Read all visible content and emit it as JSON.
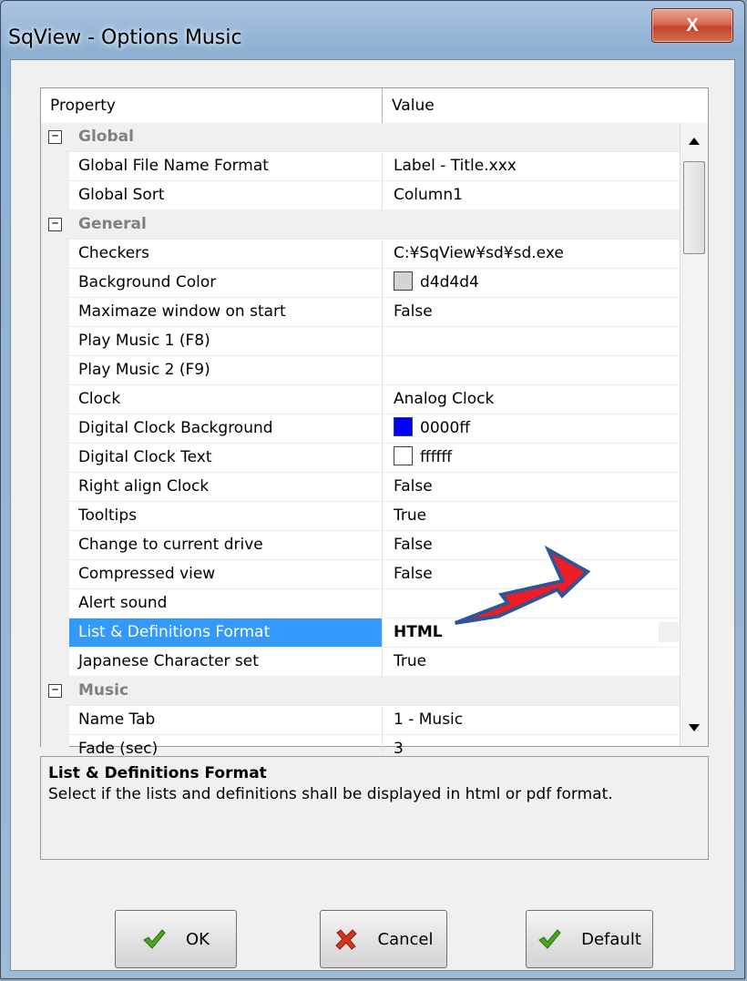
{
  "window": {
    "title": "SqView - Options Music",
    "close_label": "X"
  },
  "grid": {
    "header": {
      "property": "Property",
      "value": "Value"
    },
    "rows": [
      {
        "type": "category",
        "toggle": "⊟",
        "label": "Global"
      },
      {
        "type": "prop",
        "name": "Global File Name Format",
        "value": "Label - Title.xxx"
      },
      {
        "type": "prop",
        "name": "Global Sort",
        "value": "Column1"
      },
      {
        "type": "category",
        "toggle": "⊟",
        "label": "General"
      },
      {
        "type": "prop",
        "name": "Checkers",
        "value": "C:¥SqView¥sd¥sd.exe"
      },
      {
        "type": "prop",
        "name": "Background Color",
        "value": "d4d4d4",
        "swatch": "#d4d4d4"
      },
      {
        "type": "prop",
        "name": "Maximaze window on start",
        "value": "False"
      },
      {
        "type": "prop",
        "name": "Play Music 1 (F8)",
        "value": ""
      },
      {
        "type": "prop",
        "name": "Play Music 2 (F9)",
        "value": ""
      },
      {
        "type": "prop",
        "name": "Clock",
        "value": "Analog Clock"
      },
      {
        "type": "prop",
        "name": "Digital Clock Background",
        "value": "0000ff",
        "swatch": "#0000ff"
      },
      {
        "type": "prop",
        "name": "Digital Clock Text",
        "value": "ffffff",
        "swatch": "#ffffff"
      },
      {
        "type": "prop",
        "name": "Right align Clock",
        "value": "False"
      },
      {
        "type": "prop",
        "name": "Tooltips",
        "value": "True"
      },
      {
        "type": "prop",
        "name": "Change to current drive",
        "value": "False"
      },
      {
        "type": "prop",
        "name": "Compressed view",
        "value": "False"
      },
      {
        "type": "prop",
        "name": "Alert sound",
        "value": ""
      },
      {
        "type": "prop",
        "name": "List & Definitions Format",
        "value": "HTML",
        "selected": true
      },
      {
        "type": "prop",
        "name": "Japanese Character set",
        "value": "True"
      },
      {
        "type": "category",
        "toggle": "⊟",
        "label": "Music"
      },
      {
        "type": "prop",
        "name": "Name Tab",
        "value": "1 - Music"
      },
      {
        "type": "prop",
        "name": "Fade (sec)",
        "value": "3"
      }
    ]
  },
  "description": {
    "title": "List & Definitions Format",
    "text": "Select if the lists and definitions shall be displayed in html or pdf format."
  },
  "buttons": {
    "ok": "OK",
    "cancel": "Cancel",
    "default": "Default"
  },
  "colors": {
    "selection": "#3399ff",
    "arrow": "#ee1c24",
    "arrow_outline": "#2f5597"
  }
}
